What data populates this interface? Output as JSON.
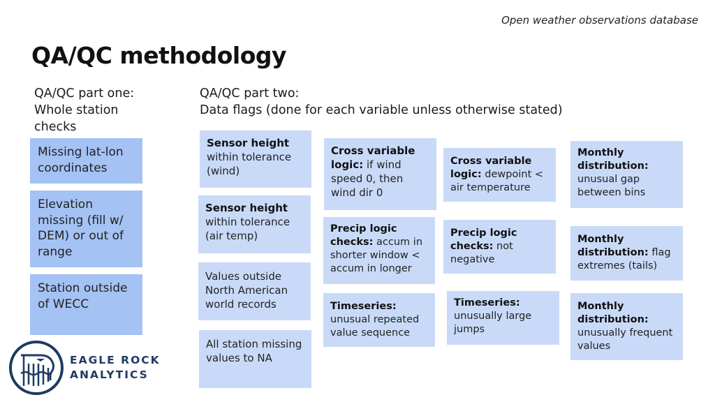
{
  "header": {
    "subtitle": "Open weather observations database",
    "title": "QA/QC methodology"
  },
  "part_one": {
    "heading_line1": "QA/QC part one:",
    "heading_line2": "Whole station",
    "heading_line3": "checks",
    "items": [
      {
        "text": "Missing lat-lon coordinates"
      },
      {
        "text": "Elevation missing (fill w/ DEM) or out of range"
      },
      {
        "text": "Station outside of WECC"
      }
    ]
  },
  "part_two": {
    "heading_line1": "QA/QC part two:",
    "heading_line2": "Data flags (done for each variable unless otherwise stated)",
    "columns": [
      [
        {
          "bold": "Sensor height",
          "rest": " within tolerance (wind)"
        },
        {
          "bold": "Sensor height",
          "rest": " within tolerance (air temp)"
        },
        {
          "bold": "",
          "rest": "Values outside North American world records"
        },
        {
          "bold": "",
          "rest": "All station missing values to NA"
        }
      ],
      [
        {
          "bold": "Cross variable logic:",
          "rest": " if wind speed 0, then wind dir 0"
        },
        {
          "bold": "Precip logic checks:",
          "rest": " accum in shorter window < accum in longer"
        },
        {
          "bold": "Timeseries:",
          "rest": " unusual repeated value sequence"
        }
      ],
      [
        {
          "bold": "Cross variable logic:",
          "rest": " dewpoint < air temperature"
        },
        {
          "bold": "Precip logic checks:",
          "rest": " not negative"
        },
        {
          "bold": "Timeseries:",
          "rest": " unusually large jumps"
        }
      ],
      [
        {
          "bold": "Monthly distribution:",
          "rest": " unusual gap between bins"
        },
        {
          "bold": "Monthly distribution:",
          "rest": " flag extremes (tails)"
        },
        {
          "bold": "Monthly distribution:",
          "rest": " unusually frequent values"
        }
      ]
    ]
  },
  "logo": {
    "line1": "EAGLE ROCK",
    "line2": "ANALYTICS"
  },
  "colors": {
    "part_one_box": "#a4c2f4",
    "part_two_box": "#c9daf8",
    "logo": "#1f3a63"
  }
}
